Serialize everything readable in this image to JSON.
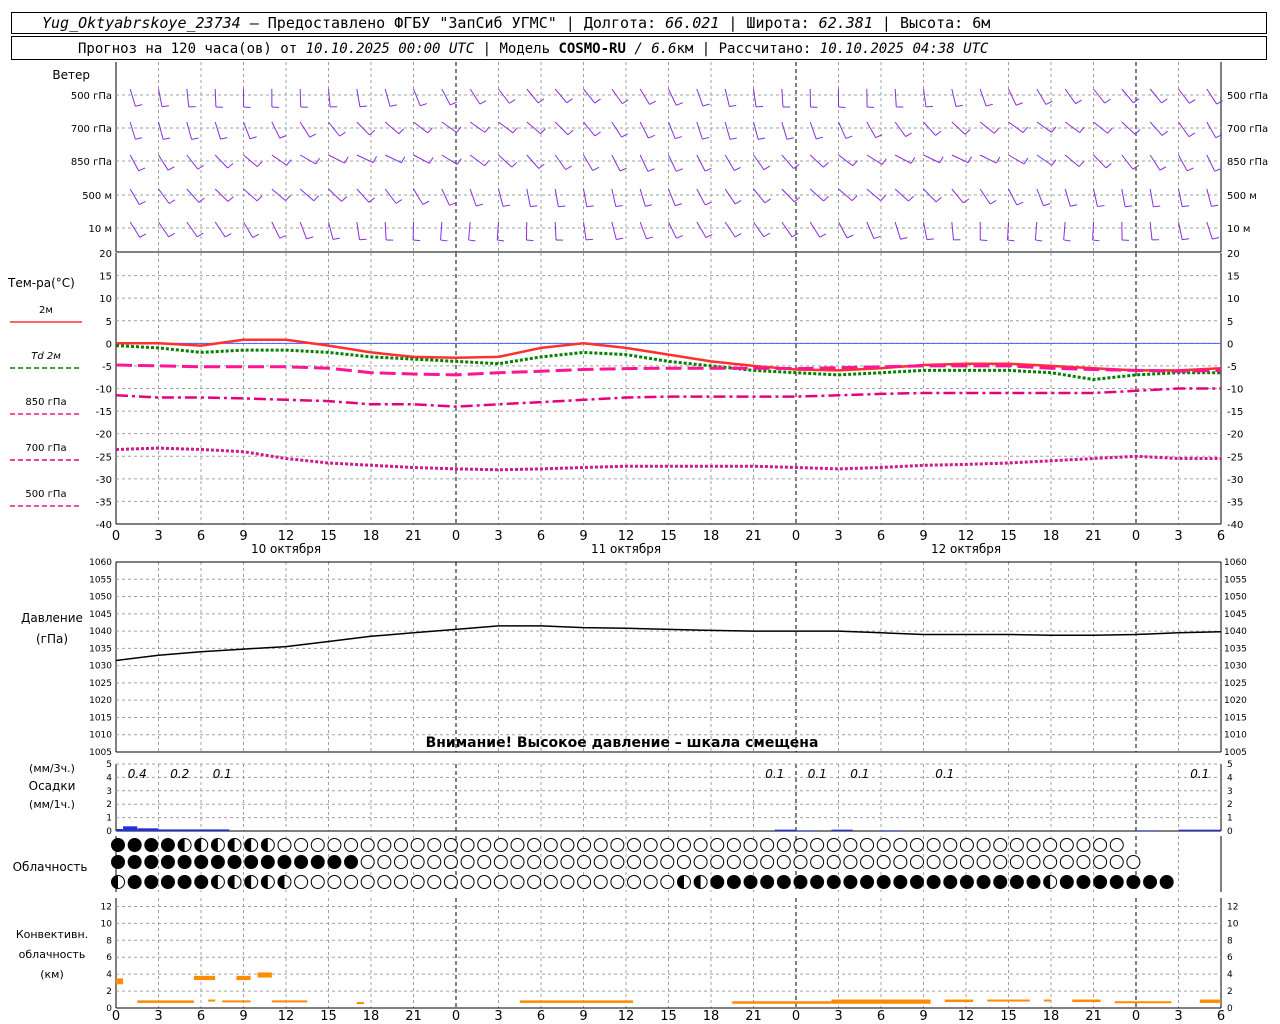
{
  "header": {
    "station": "Yug_Oktyabrskoye_23734",
    "dash": " – ",
    "provided_by": "Предоставлено ФГБУ \"ЗапСиб УГМС\"",
    "sep": " | ",
    "lon_label": "Долгота: ",
    "lon_value": "66.021",
    "lat_label": "Широта: ",
    "lat_value": "62.381",
    "alt_label": "Высота: 6м",
    "forecast_label": "Прогноз на 120 часа(ов) от ",
    "forecast_time": "10.10.2025 00:00 UTC",
    "model_label": " | Модель ",
    "model_name": "COSMO-RU",
    "model_res_sep": " / ",
    "model_res": "6.6",
    "model_res_unit": "км",
    "calc_label": " | Рассчитано: ",
    "calc_time": "10.10.2025 04:38 UTC"
  },
  "colors": {
    "wind": "#8a2be2",
    "t2m": "#ff3030",
    "td2m": "#008000",
    "t850": "#ff1493",
    "t700": "#e6007e",
    "t500": "#d01890",
    "precip": "#2030e0",
    "convective": "#ff8c00",
    "grid": "#a0a0a0",
    "zero_line": "#4060ff"
  },
  "labels": {
    "wind_title": "Ветер",
    "temp_title": "Тем-ра(°C)",
    "pressure_title1": "Давление",
    "pressure_title2": "(гПа)",
    "pressure_warning": "Внимание! Высокое давление – шкала смещена",
    "precip_unit3": "(мм/3ч.)",
    "precip_title": "Осадки",
    "precip_unit1": "(мм/1ч.)",
    "cloud_title": "Облачность",
    "conv_title1": "Конвективн.",
    "conv_title2": "облачность",
    "conv_title3": "(км)",
    "date_labels": [
      "10 октября",
      "11 октября",
      "12 октября"
    ]
  },
  "chart_data": [
    {
      "type": "wind-barbs",
      "levels": [
        "500 гПа",
        "700 гПа",
        "850 гПа",
        "500 м",
        "10   м"
      ]
    },
    {
      "type": "line",
      "x_ticks": [
        "0",
        "3",
        "6",
        "9",
        "12",
        "15",
        "18",
        "21",
        "0",
        "3",
        "6",
        "9",
        "12",
        "15",
        "18",
        "21",
        "0",
        "3",
        "6",
        "9",
        "12",
        "15",
        "18",
        "21",
        "0",
        "3",
        "6"
      ],
      "y_ticks": [
        20,
        15,
        10,
        5,
        0,
        -5,
        -10,
        -15,
        -20,
        -25,
        -30,
        -35,
        -40
      ],
      "ylim": [
        -40,
        20
      ],
      "x_hours": [
        0,
        6,
        12,
        18,
        24,
        30,
        36,
        42,
        48,
        54,
        60,
        66,
        72,
        78,
        84,
        90,
        96,
        102,
        108,
        114,
        120,
        126,
        132,
        138,
        144,
        150,
        156
      ],
      "series": [
        {
          "name": "2м",
          "values": [
            0,
            0,
            -0.5,
            0.8,
            0.8,
            -0.5,
            -2,
            -3,
            -3.2,
            -3,
            -1,
            0,
            -1,
            -2.5,
            -4,
            -5,
            -5.8,
            -6,
            -5.5,
            -4.8,
            -4.5,
            -4.5,
            -5,
            -5.5,
            -6,
            -6,
            -5.5
          ]
        },
        {
          "name": "Td 2м",
          "values": [
            -0.5,
            -1,
            -2,
            -1.5,
            -1.5,
            -2,
            -3,
            -3.5,
            -4,
            -4.5,
            -3,
            -2,
            -2.5,
            -4,
            -5,
            -6,
            -6.5,
            -7,
            -6.5,
            -6,
            -6,
            -6,
            -6.5,
            -8,
            -7,
            -6.5,
            -6.5
          ]
        },
        {
          "name": "850 гПа",
          "values": [
            -4.8,
            -5,
            -5.2,
            -5.2,
            -5.2,
            -5.5,
            -6.5,
            -6.8,
            -7,
            -6.5,
            -6.2,
            -5.8,
            -5.6,
            -5.5,
            -5.5,
            -5.5,
            -5.6,
            -5.4,
            -5.2,
            -5,
            -5,
            -5,
            -5.5,
            -5.8,
            -6,
            -6.2,
            -6
          ]
        },
        {
          "name": "700 гПа",
          "values": [
            -11.5,
            -12,
            -12,
            -12.2,
            -12.5,
            -12.8,
            -13.5,
            -13.5,
            -14,
            -13.5,
            -13,
            -12.5,
            -12,
            -11.8,
            -11.8,
            -11.8,
            -11.8,
            -11.5,
            -11.2,
            -11,
            -11,
            -11,
            -11,
            -11,
            -10.5,
            -10,
            -10
          ]
        },
        {
          "name": "500 гПа",
          "values": [
            -23.5,
            -23.2,
            -23.5,
            -24,
            -25.5,
            -26.5,
            -27,
            -27.5,
            -27.8,
            -28,
            -27.8,
            -27.5,
            -27.2,
            -27.2,
            -27.2,
            -27.2,
            -27.5,
            -27.8,
            -27.5,
            -27,
            -26.8,
            -26.5,
            -26,
            -25.5,
            -25,
            -25.5,
            -25.5
          ]
        }
      ]
    },
    {
      "type": "line",
      "y_ticks": [
        1060,
        1055,
        1050,
        1045,
        1040,
        1035,
        1030,
        1025,
        1020,
        1015,
        1010,
        1005
      ],
      "ylim": [
        1005,
        1060
      ],
      "x_hours": [
        0,
        6,
        12,
        18,
        24,
        30,
        36,
        42,
        48,
        54,
        60,
        66,
        72,
        78,
        84,
        90,
        96,
        102,
        108,
        114,
        120,
        126,
        132,
        138,
        144,
        150,
        156
      ],
      "series": [
        {
          "name": "Давление",
          "values": [
            1031.5,
            1033,
            1034,
            1034.8,
            1035.5,
            1037,
            1038.5,
            1039.5,
            1040.5,
            1041.5,
            1041.5,
            1041,
            1040.8,
            1040.5,
            1040.2,
            1040,
            1040,
            1040,
            1039.5,
            1039,
            1039,
            1039,
            1038.8,
            1038.8,
            1039,
            1039.5,
            1039.8
          ]
        }
      ]
    },
    {
      "type": "bar",
      "y_ticks_3h": [
        5,
        4,
        3,
        2,
        1,
        0
      ],
      "y_ticks_1h": [
        5,
        4,
        3,
        2,
        1,
        0
      ],
      "ylim": [
        0,
        5
      ],
      "labels": [
        {
          "hour": 3,
          "text": "0.4"
        },
        {
          "hour": 9,
          "text": "0.2"
        },
        {
          "hour": 15,
          "text": "0.1"
        },
        {
          "hour": 93,
          "text": "0.1"
        },
        {
          "hour": 99,
          "text": "0.1"
        },
        {
          "hour": 105,
          "text": "0.1"
        },
        {
          "hour": 117,
          "text": "0.1"
        },
        {
          "hour": 153,
          "text": "0.1"
        }
      ],
      "bars": [
        {
          "from": 0,
          "to": 1,
          "value": 0.15
        },
        {
          "from": 1,
          "to": 3,
          "value": 0.35
        },
        {
          "from": 3,
          "to": 6,
          "value": 0.2
        },
        {
          "from": 6,
          "to": 16,
          "value": 0.12
        },
        {
          "from": 93,
          "to": 96,
          "value": 0.1
        },
        {
          "from": 96,
          "to": 99,
          "value": 0.05
        },
        {
          "from": 101,
          "to": 104,
          "value": 0.1
        },
        {
          "from": 108,
          "to": 111,
          "value": 0.05
        },
        {
          "from": 144,
          "to": 147,
          "value": 0.05
        },
        {
          "from": 150,
          "to": 156,
          "value": 0.1
        }
      ]
    },
    {
      "type": "table",
      "rows": 3,
      "interval_hours": 3,
      "top": "●●●●◐◐◐◐◐◐○○○○○○○○○○○○○○○○○○○○○○○○○○○○○○○○○○○○○○○○○○○○○○○○○○○",
      "middle": "●●●●●●●●●●●●●●●○○○○○○○○○○○○○○○○○○○○○○○○○○○○○○○○○○○○○○○○○○○○○○○",
      "bottom": "◐●●●●●◐◐◐◐◐○○○○○○○○○○○○○○○○○○○○○○○◐◐●●●●●●●●●●●●●●●●●●●●◐●●●●●●●"
    },
    {
      "type": "bar",
      "y_ticks": [
        12,
        10,
        8,
        6,
        4,
        2,
        0
      ],
      "ylim": [
        0,
        13
      ],
      "segments": [
        {
          "from": 0,
          "to": 1,
          "base": 2.8,
          "top": 3.5
        },
        {
          "from": 3,
          "to": 5,
          "base": 0.6,
          "top": 0.9
        },
        {
          "from": 5,
          "to": 11,
          "base": 0.6,
          "top": 0.9
        },
        {
          "from": 11,
          "to": 14,
          "base": 3.3,
          "top": 3.8
        },
        {
          "from": 13,
          "to": 14,
          "base": 0.8,
          "top": 1.0
        },
        {
          "from": 15,
          "to": 19,
          "base": 0.7,
          "top": 0.9
        },
        {
          "from": 17,
          "to": 19,
          "base": 3.3,
          "top": 3.8
        },
        {
          "from": 20,
          "to": 22,
          "base": 3.6,
          "top": 4.2
        },
        {
          "from": 22,
          "to": 27,
          "base": 0.7,
          "top": 0.9
        },
        {
          "from": 34,
          "to": 35,
          "base": 0.5,
          "top": 0.7
        },
        {
          "from": 57,
          "to": 73,
          "base": 0.6,
          "top": 0.9
        },
        {
          "from": 87,
          "to": 101,
          "base": 0.5,
          "top": 0.8
        },
        {
          "from": 101,
          "to": 115,
          "base": 0.5,
          "top": 1.0
        },
        {
          "from": 117,
          "to": 121,
          "base": 0.7,
          "top": 1.0
        },
        {
          "from": 123,
          "to": 129,
          "base": 0.8,
          "top": 1.0
        },
        {
          "from": 131,
          "to": 132,
          "base": 0.8,
          "top": 1.0
        },
        {
          "from": 135,
          "to": 139,
          "base": 0.7,
          "top": 1.0
        },
        {
          "from": 141,
          "to": 149,
          "base": 0.6,
          "top": 0.8
        },
        {
          "from": 153,
          "to": 156,
          "base": 0.6,
          "top": 1.0
        }
      ]
    }
  ]
}
